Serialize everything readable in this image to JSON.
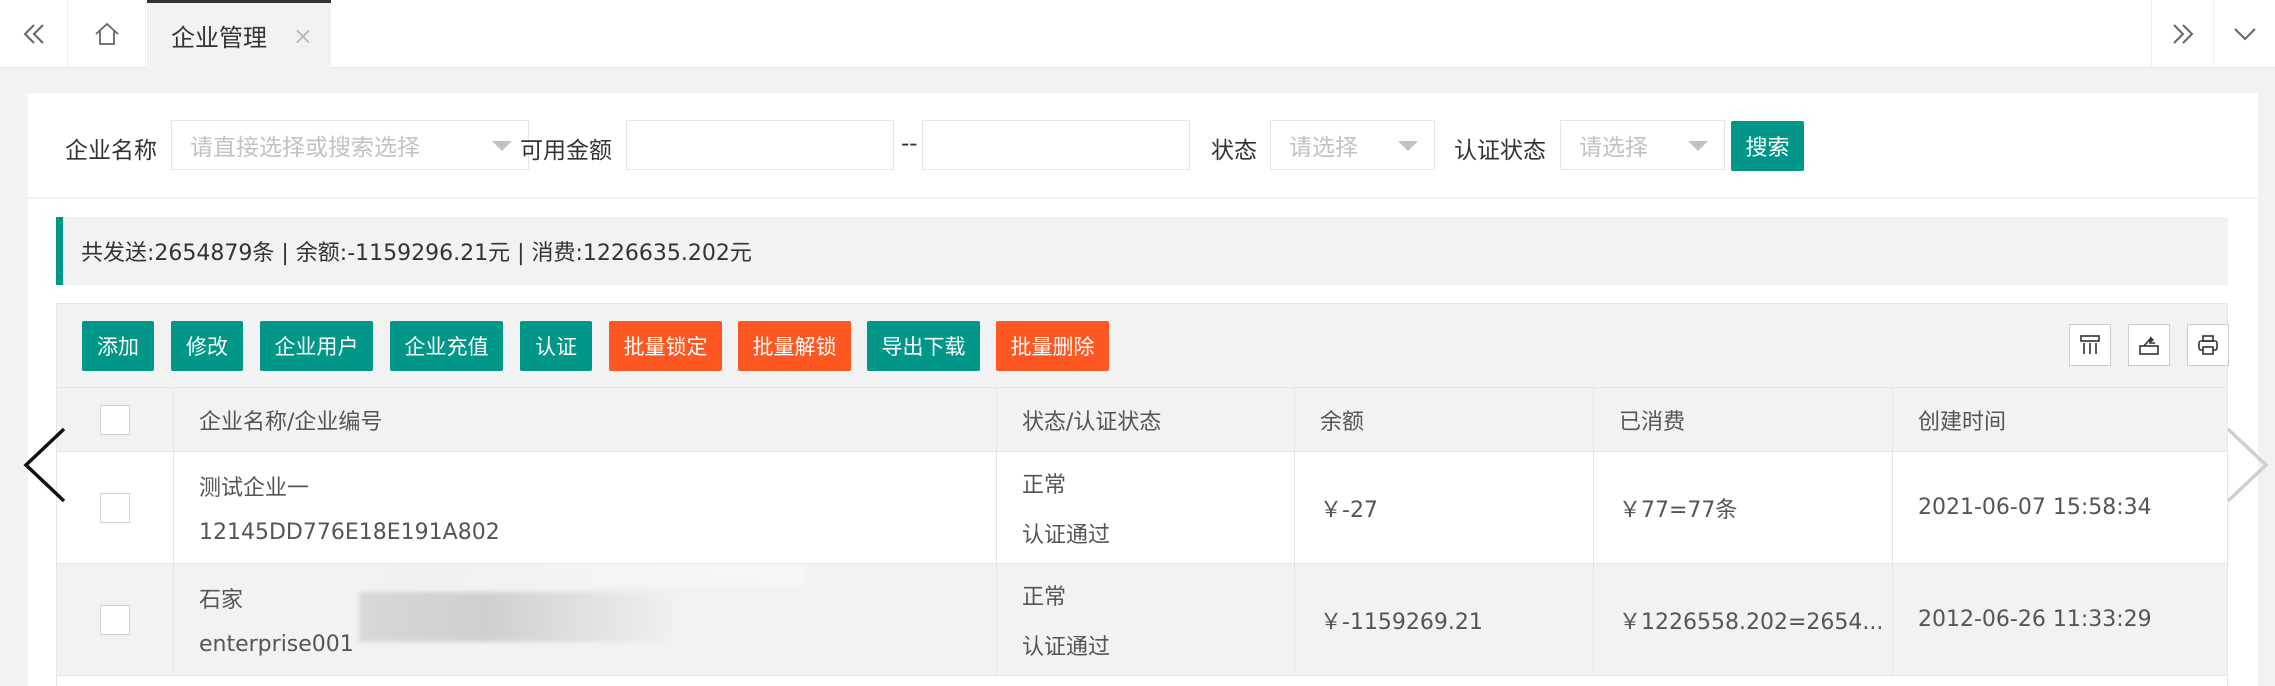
{
  "tabs": {
    "active_label": "企业管理",
    "close_glyph": "×"
  },
  "search": {
    "name_label": "企业名称",
    "name_placeholder": "请直接选择或搜索选择",
    "amount_label": "可用金额",
    "amount_from": "",
    "amount_to": "",
    "range_separator": "--",
    "status_label": "状态",
    "status_placeholder": "请选择",
    "cert_label": "认证状态",
    "cert_placeholder": "请选择",
    "search_button": "搜索"
  },
  "summary": {
    "text": "共发送:2654879条 | 余额:-1159296.21元 | 消费:1226635.202元"
  },
  "toolbar": {
    "buttons": [
      "添加",
      "修改",
      "企业用户",
      "企业充值",
      "认证",
      "批量锁定",
      "批量解锁",
      "导出下载",
      "批量删除"
    ],
    "icons": [
      "columns-icon",
      "export-icon",
      "print-icon"
    ]
  },
  "table": {
    "headers": [
      "企业名称/企业编号",
      "状态/认证状态",
      "余额",
      "已消费",
      "创建时间"
    ],
    "rows": [
      {
        "name": "测试企业一",
        "code": "12145DD776E18E191A802",
        "status": "正常",
        "cert": "认证通过",
        "balance": "￥-27",
        "consumed": "￥77=77条",
        "created": "2021-06-07 15:58:34"
      },
      {
        "name": "石家",
        "code": "enterprise001",
        "status": "正常",
        "cert": "认证通过",
        "balance": "￥-1159269.21",
        "consumed": "￥1226558.202=2654...",
        "created": "2012-06-26 11:33:29"
      }
    ]
  },
  "colors": {
    "primary": "#009688",
    "danger": "#ff5722"
  }
}
